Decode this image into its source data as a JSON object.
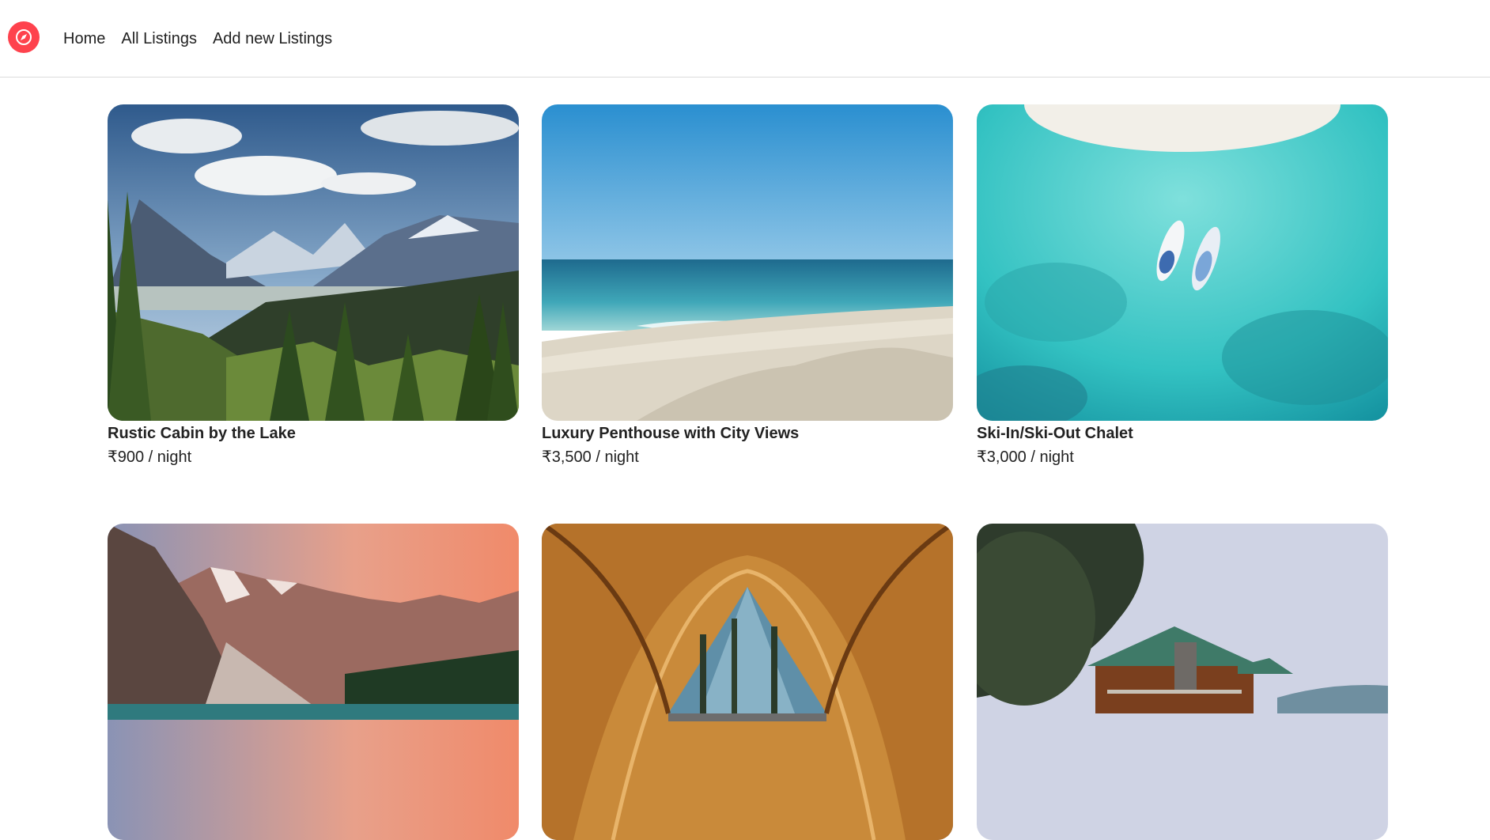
{
  "nav": {
    "logo_icon": "compass-icon",
    "brand_color": "#fe424d",
    "links": [
      "Home",
      "All Listings",
      "Add new Listings"
    ]
  },
  "listings": [
    {
      "title": "Rustic Cabin by the Lake",
      "price": "₹900 / night",
      "image": "mountain-valley-forest"
    },
    {
      "title": "Luxury Penthouse with City Views",
      "price": "₹3,500 / night",
      "image": "tropical-beach"
    },
    {
      "title": "Ski-In/Ski-Out Chalet",
      "price": "₹3,000 / night",
      "image": "turquoise-water-boats"
    },
    {
      "title": "",
      "price": "",
      "image": "pink-mountains-lake"
    },
    {
      "title": "",
      "price": "",
      "image": "tent-forest-view"
    },
    {
      "title": "",
      "price": "",
      "image": "log-cabin-trees"
    }
  ]
}
